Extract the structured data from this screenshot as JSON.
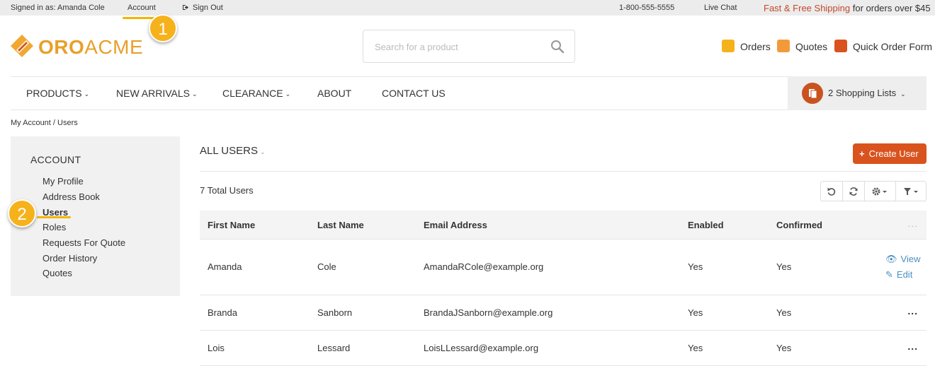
{
  "topbar": {
    "signed_in": "Signed in as: Amanda Cole",
    "account": "Account",
    "sign_out": "Sign Out",
    "phone": "1-800-555-5555",
    "live_chat": "Live Chat",
    "shipping_highlight": "Fast & Free Shipping",
    "shipping_rest": " for orders over $45"
  },
  "callouts": {
    "one": "1",
    "two": "2"
  },
  "brand": {
    "logo_text_a": "ORO",
    "logo_text_b": "ACME",
    "accent": "#d9531e",
    "logo_color": "#e8a02a"
  },
  "search": {
    "placeholder": "Search for a product"
  },
  "header_links": {
    "orders": "Orders",
    "quotes": "Quotes",
    "quick_order": "Quick Order Form"
  },
  "nav": {
    "items": [
      "PRODUCTS",
      "NEW ARRIVALS",
      "CLEARANCE",
      "ABOUT",
      "CONTACT US"
    ],
    "shopping_lists": "2 Shopping Lists"
  },
  "breadcrumb": "My Account / Users",
  "sidebar": {
    "title": "ACCOUNT",
    "items": [
      "My Profile",
      "Address Book",
      "Users",
      "Roles",
      "Requests For Quote",
      "Order History",
      "Quotes"
    ]
  },
  "main": {
    "title": "ALL USERS",
    "create_button": "Create User",
    "total": "7 Total Users"
  },
  "table": {
    "columns": [
      "First Name",
      "Last Name",
      "Email Address",
      "Enabled",
      "Confirmed"
    ],
    "rows": [
      [
        "Amanda",
        "Cole",
        "AmandaRCole@example.org",
        "Yes",
        "Yes"
      ],
      [
        "Branda",
        "Sanborn",
        "BrandaJSanborn@example.org",
        "Yes",
        "Yes"
      ],
      [
        "Lois",
        "Lessard",
        "LoisLLessard@example.org",
        "Yes",
        "Yes"
      ]
    ],
    "row_actions": {
      "view": "View",
      "edit": "Edit"
    },
    "more": "..."
  }
}
